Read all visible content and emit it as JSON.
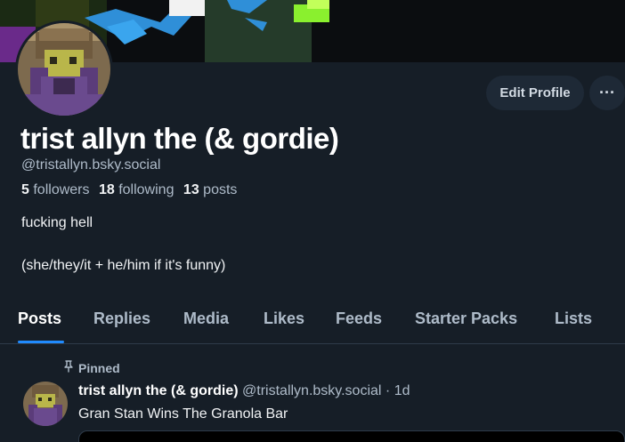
{
  "profile": {
    "display_name": "trist allyn the (& gordie)",
    "handle": "@tristallyn.bsky.social",
    "stats": {
      "followers_count": "5",
      "followers_label": "followers",
      "following_count": "18",
      "following_label": "following",
      "posts_count": "13",
      "posts_label": "posts"
    },
    "bio_line1": "fucking hell",
    "bio_line2": "(she/they/it + he/him if it's funny)"
  },
  "actions": {
    "edit_profile_label": "Edit Profile",
    "more_label": "···"
  },
  "tabs": [
    {
      "label": "Posts",
      "active": true
    },
    {
      "label": "Replies",
      "active": false
    },
    {
      "label": "Media",
      "active": false
    },
    {
      "label": "Likes",
      "active": false
    },
    {
      "label": "Feeds",
      "active": false
    },
    {
      "label": "Starter Packs",
      "active": false
    },
    {
      "label": "Lists",
      "active": false
    }
  ],
  "pinned_post": {
    "pinned_label": "Pinned",
    "author_name": "trist allyn the (& gordie)",
    "author_handle": "@tristallyn.bsky.social",
    "separator": "·",
    "time": "1d",
    "text": "Gran Stan Wins The Granola Bar"
  },
  "colors": {
    "background": "#161e27",
    "accent": "#208bfe",
    "muted_text": "#aebbc9",
    "button_bg": "#1e2936"
  },
  "icons": {
    "pin": "pin-icon",
    "more": "more-horizontal-icon"
  }
}
